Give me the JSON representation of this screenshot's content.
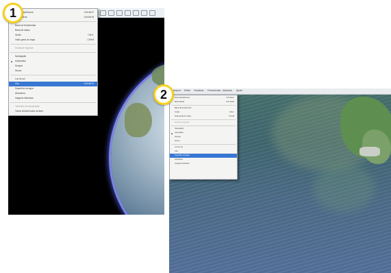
{
  "badges": {
    "one": "1",
    "two": "2"
  },
  "shot1": {
    "menu_items": [
      {
        "label": "Tela inteira/Normal",
        "shortcut": "Ctrl+Alt+F"
      },
      {
        "label": "Barra lateral",
        "shortcut": "Ctrl+Alt+B"
      },
      {
        "label": "Barra de ferramentas",
        "shortcut": ""
      },
      {
        "label": "Barra de status",
        "shortcut": ""
      },
      {
        "label": "Grade",
        "shortcut": "Ctrl+L"
      },
      {
        "label": "Visão geral do mapa",
        "shortcut": "Ctrl+M"
      },
      {
        "label": "Escala de legenda",
        "shortcut": ""
      },
      {
        "label": "Navegação",
        "shortcut": ""
      },
      {
        "label": "Automático",
        "shortcut": ""
      },
      {
        "label": "Sempre",
        "shortcut": ""
      },
      {
        "label": "Nunca",
        "shortcut": ""
      },
      {
        "label": "Luz do sol",
        "shortcut": ""
      },
      {
        "label": "Céu",
        "shortcut": "Ctrl+Alt+S"
      },
      {
        "label": "Superfície da água",
        "shortcut": ""
      },
      {
        "label": "Atmosfera",
        "shortcut": ""
      },
      {
        "label": "Imagens históricas",
        "shortcut": ""
      },
      {
        "label": "Tamanho da visualização",
        "shortcut": ""
      },
      {
        "label": "Tornar visíveis todos os itens",
        "shortcut": ""
      }
    ]
  },
  "shot2": {
    "toolbar_items": [
      "Arquivo",
      "Editar",
      "Visualizar",
      "Ferramentas",
      "Adicionar",
      "Ajuda"
    ],
    "menu_items": [
      {
        "label": "Tela inteira/Normal",
        "shortcut": "Ctrl+Alt+F"
      },
      {
        "label": "Barra lateral",
        "shortcut": "Ctrl+Alt+B"
      },
      {
        "label": "Barra de ferramentas",
        "shortcut": ""
      },
      {
        "label": "Grade",
        "shortcut": "Ctrl+L"
      },
      {
        "label": "Visão geral do mapa",
        "shortcut": "Ctrl+M"
      },
      {
        "label": "Escala de legenda",
        "shortcut": ""
      },
      {
        "label": "Navegação",
        "shortcut": ""
      },
      {
        "label": "Automático",
        "shortcut": ""
      },
      {
        "label": "Sempre",
        "shortcut": ""
      },
      {
        "label": "Nunca",
        "shortcut": ""
      },
      {
        "label": "Luz do sol",
        "shortcut": ""
      },
      {
        "label": "Céu",
        "shortcut": ""
      },
      {
        "label": "Superfície da água",
        "shortcut": ""
      },
      {
        "label": "Atmosfera",
        "shortcut": ""
      },
      {
        "label": "Imagens históricas",
        "shortcut": ""
      }
    ]
  }
}
